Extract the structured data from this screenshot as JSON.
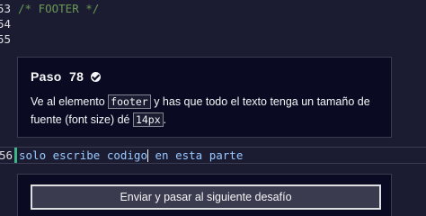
{
  "editor": {
    "lines": [
      {
        "number": "53",
        "text": "/* FOOTER */"
      },
      {
        "number": "54",
        "text": ""
      },
      {
        "number": "55",
        "text": ""
      }
    ],
    "active_line": {
      "number": "56",
      "before_cursor": "solo escribe codigo",
      "after_cursor": " en esta parte"
    }
  },
  "step": {
    "title": "Paso  78",
    "desc_part1": "Ve al elemento ",
    "code_element": "footer",
    "desc_part2": " y has que todo el texto tenga un tamaño de fuente (font size) dé ",
    "code_value": "14px",
    "desc_part3": "."
  },
  "actions": {
    "submit_label": "Enviar y pasar al siguiente desafío"
  },
  "icons": {
    "step_status": "check-circle-icon"
  },
  "colors": {
    "background": "#1b1b32",
    "panel": "#0a0a23",
    "comment": "#6a9955",
    "code_text": "#99c9ff",
    "edit_marker": "#3eb489"
  }
}
